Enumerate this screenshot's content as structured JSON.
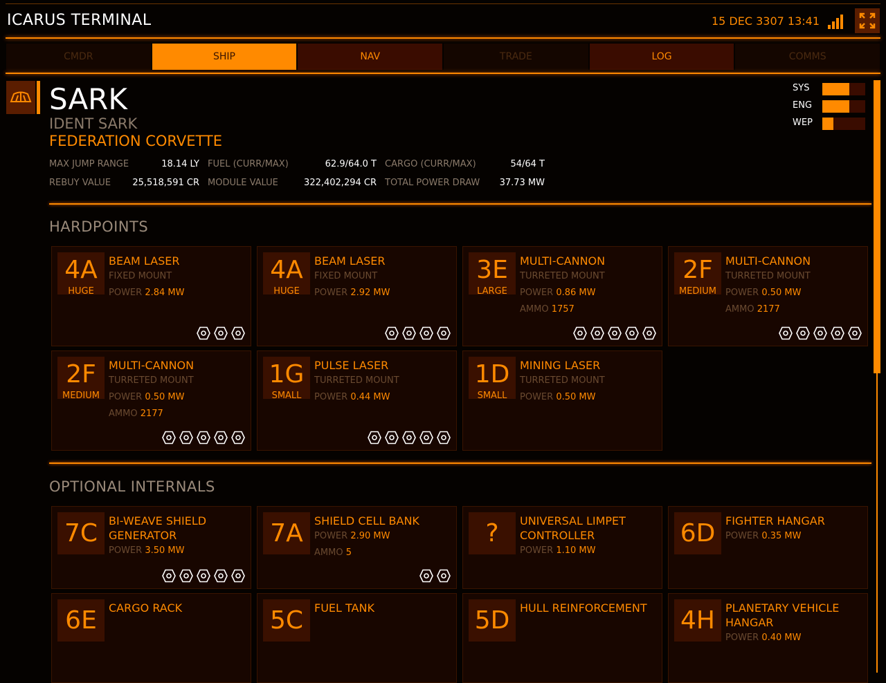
{
  "header": {
    "app_title": "ICARUS TERMINAL",
    "datetime": "15 DEC 3307 13:41",
    "signal_icon": "signal-strength-icon",
    "fullscreen_icon": "fullscreen-icon"
  },
  "nav": {
    "tabs": [
      {
        "label": "CMDR",
        "state": "disabled"
      },
      {
        "label": "SHIP",
        "state": "active"
      },
      {
        "label": "NAV",
        "state": "enabled"
      },
      {
        "label": "TRADE",
        "state": "disabled"
      },
      {
        "label": "LOG",
        "state": "enabled"
      },
      {
        "label": "COMMS",
        "state": "disabled"
      }
    ]
  },
  "ship": {
    "name": "SARK",
    "ident": "IDENT SARK",
    "type": "FEDERATION CORVETTE",
    "stats": [
      {
        "label": "MAX JUMP RANGE",
        "value": "18.14 LY"
      },
      {
        "label": "FUEL (CURR/MAX)",
        "value": "62.9/64.0 T"
      },
      {
        "label": "CARGO (CURR/MAX)",
        "value": "54/64 T"
      },
      {
        "label": "REBUY VALUE",
        "value": "25,518,591 CR"
      },
      {
        "label": "MODULE VALUE",
        "value": "322,402,294 CR"
      },
      {
        "label": "TOTAL POWER DRAW",
        "value": "37.73 MW"
      }
    ]
  },
  "power_distributor": [
    {
      "label": "SYS",
      "level": 0.625
    },
    {
      "label": "ENG",
      "level": 0.625
    },
    {
      "label": "WEP",
      "level": 0.25
    }
  ],
  "sections": {
    "hardpoints": "HARDPOINTS",
    "optional_internals": "OPTIONAL INTERNALS"
  },
  "labels": {
    "power": "POWER",
    "ammo": "AMMO"
  },
  "hardpoints": [
    {
      "class": "4A",
      "size": "HUGE",
      "name": "BEAM LASER",
      "mount": "FIXED MOUNT",
      "power": "2.84 MW",
      "ammo": "",
      "engineering": 3
    },
    {
      "class": "4A",
      "size": "HUGE",
      "name": "BEAM LASER",
      "mount": "FIXED MOUNT",
      "power": "2.92 MW",
      "ammo": "",
      "engineering": 4
    },
    {
      "class": "3E",
      "size": "LARGE",
      "name": "MULTI-CANNON",
      "mount": "TURRETED MOUNT",
      "power": "0.86 MW",
      "ammo": "1757",
      "engineering": 5
    },
    {
      "class": "2F",
      "size": "MEDIUM",
      "name": "MULTI-CANNON",
      "mount": "TURRETED MOUNT",
      "power": "0.50 MW",
      "ammo": "2177",
      "engineering": 5
    },
    {
      "class": "2F",
      "size": "MEDIUM",
      "name": "MULTI-CANNON",
      "mount": "TURRETED MOUNT",
      "power": "0.50 MW",
      "ammo": "2177",
      "engineering": 5
    },
    {
      "class": "1G",
      "size": "SMALL",
      "name": "PULSE LASER",
      "mount": "TURRETED MOUNT",
      "power": "0.44 MW",
      "ammo": "",
      "engineering": 5
    },
    {
      "class": "1D",
      "size": "SMALL",
      "name": "MINING LASER",
      "mount": "TURRETED MOUNT",
      "power": "0.50 MW",
      "ammo": "",
      "engineering": 0
    }
  ],
  "internals": [
    {
      "class": "7C",
      "name": "BI-WEAVE SHIELD GENERATOR",
      "power": "3.50 MW",
      "ammo": "",
      "engineering": 5
    },
    {
      "class": "7A",
      "name": "SHIELD CELL BANK",
      "power": "2.90 MW",
      "ammo": "5",
      "engineering": 2
    },
    {
      "class": "?",
      "name": "UNIVERSAL LIMPET CONTROLLER",
      "power": "1.10 MW",
      "ammo": "",
      "engineering": 0
    },
    {
      "class": "6D",
      "name": "FIGHTER HANGAR",
      "power": "0.35 MW",
      "ammo": "",
      "engineering": 0
    },
    {
      "class": "6E",
      "name": "CARGO RACK",
      "power": "",
      "ammo": "",
      "engineering": 0
    },
    {
      "class": "5C",
      "name": "FUEL TANK",
      "power": "",
      "ammo": "",
      "engineering": 0
    },
    {
      "class": "5D",
      "name": "HULL REINFORCEMENT",
      "power": "",
      "ammo": "",
      "engineering": 0
    },
    {
      "class": "4H",
      "name": "PLANETARY VEHICLE HANGAR",
      "power": "0.40 MW",
      "ammo": "",
      "engineering": 0
    }
  ]
}
